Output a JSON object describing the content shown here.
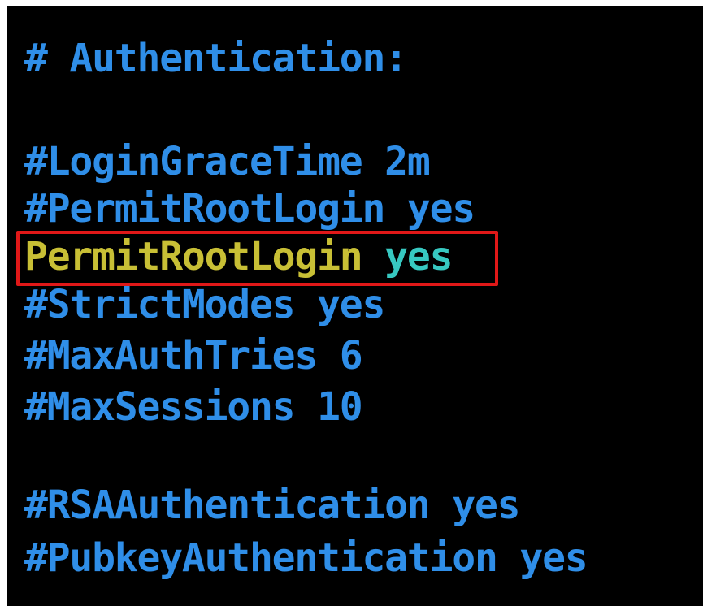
{
  "terminal": {
    "lines": {
      "authentication_header": "# Authentication:",
      "login_grace_time": "#LoginGraceTime 2m",
      "permit_root_login_commented": "#PermitRootLogin yes",
      "permit_root_login_key": "PermitRootLogin",
      "permit_root_login_value": "yes",
      "strict_modes": "#StrictModes yes",
      "max_auth_tries": "#MaxAuthTries 6",
      "max_sessions": "#MaxSessions 10",
      "rsa_authentication": "#RSAAuthentication yes",
      "pubkey_authentication": "#PubkeyAuthentication yes"
    },
    "colors": {
      "background": "#000000",
      "comment": "#2f8ee8",
      "keyword": "#c8bf35",
      "value": "#37c8c1",
      "highlight_box": "#e01818"
    }
  }
}
